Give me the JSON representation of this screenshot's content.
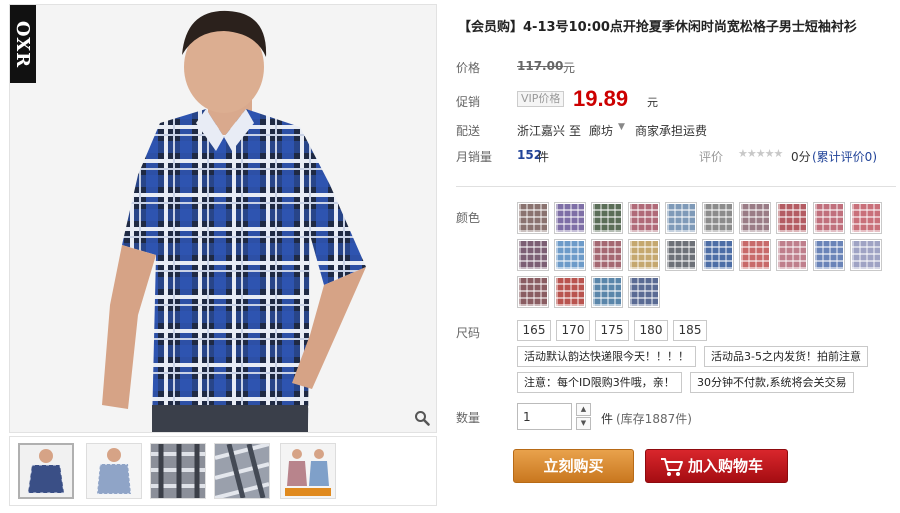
{
  "brand": {
    "logo_text": "OXR"
  },
  "product": {
    "title": "【会员购】4-13号10:00点开抢夏季休闲时尚宽松格子男士短袖衬衫"
  },
  "price": {
    "label": "价格",
    "original": "117.00",
    "unit": "元"
  },
  "promo": {
    "label": "促销",
    "tag": "VIP价格",
    "price": "19.89",
    "unit": "元"
  },
  "shipping": {
    "label": "配送",
    "from": "浙江嘉兴",
    "to_word": "至",
    "destination": "廊坊",
    "note": "商家承担运费"
  },
  "sales": {
    "label": "月销量",
    "count": "152",
    "unit": "件",
    "rating_label": "评价",
    "stars": "★★★★★",
    "score": "0分",
    "review_link": "(累计评价0)"
  },
  "colors": {
    "label": "颜色",
    "swatch_colors": [
      "#8a7370",
      "#7e6fa6",
      "#5b6e58",
      "#b06a78",
      "#7f9ab8",
      "#8c8c8c",
      "#9a7c86",
      "#b45c63",
      "#c06f7c",
      "#c9707a",
      "#7c5f74",
      "#6d9bc9",
      "#a56872",
      "#c5a86f",
      "#6d7178",
      "#4d6ea6",
      "#c86a6a",
      "#bf7f8c",
      "#6a84b8",
      "#9fa3c4",
      "#8a5d62",
      "#b9544f",
      "#5a86aa",
      "#5a6b94"
    ]
  },
  "sizes": {
    "label": "尺码",
    "options": [
      "165",
      "170",
      "175",
      "180",
      "185"
    ]
  },
  "notes": [
    "活动默认韵达快递限今天！！！！",
    "活动品3-5之内发货！拍前注意",
    "注意：每个ID限购3件哦，亲！",
    "30分钟不付款,系统将会关交易"
  ],
  "quantity": {
    "label": "数量",
    "value": "1",
    "unit": "件",
    "stock": "(库存1887件)"
  },
  "actions": {
    "buy_now": "立刻购买",
    "add_to_cart": "加入购物车"
  },
  "icons": {
    "zoom": "zoom-icon",
    "cart": "cart-icon"
  },
  "accent_colors": {
    "price_red": "#cc0000",
    "buy_now_orange": "#d48a2f",
    "cart_red": "#c0161c"
  }
}
